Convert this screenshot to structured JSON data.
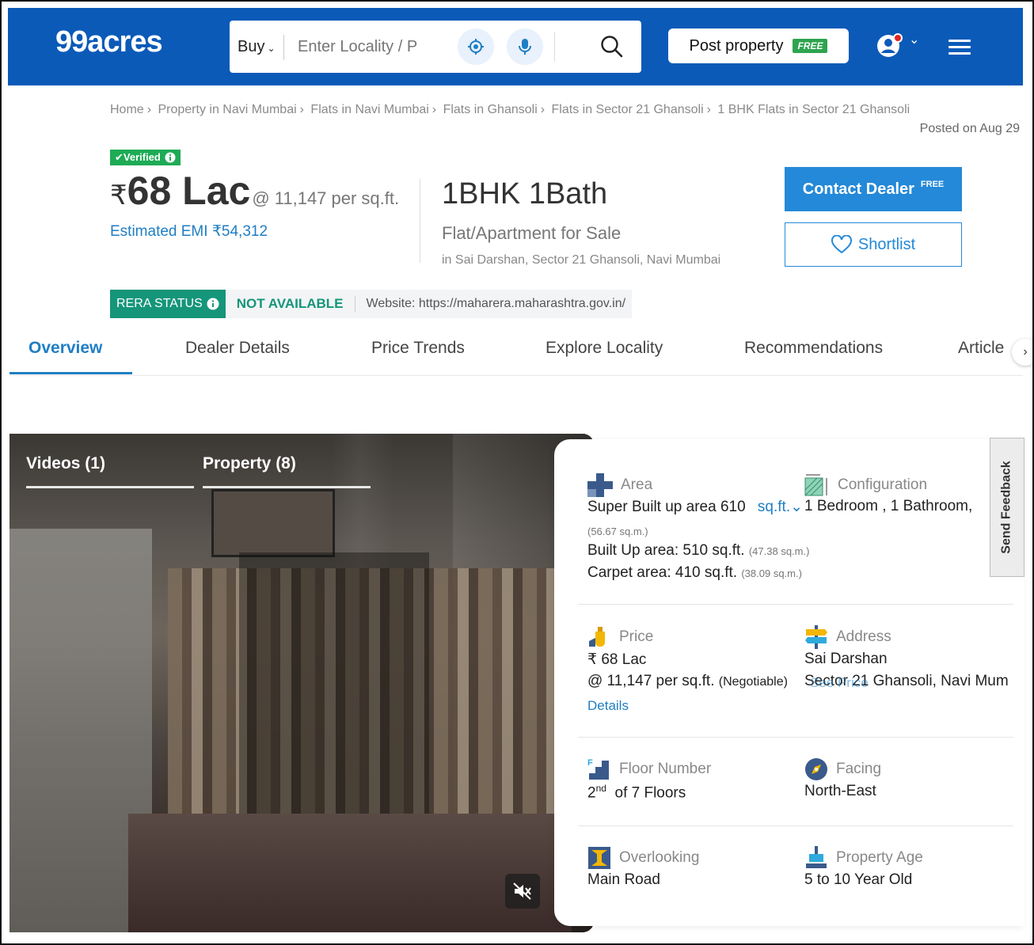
{
  "header": {
    "logo": "99acres",
    "search": {
      "mode": "Buy",
      "placeholder": "Enter Locality / P"
    },
    "post_property": {
      "label": "Post property",
      "badge": "FREE"
    }
  },
  "breadcrumb": {
    "items": [
      "Home",
      "Property in Navi Mumbai",
      "Flats in Navi Mumbai",
      "Flats in Ghansoli",
      "Flats in Sector 21 Ghansoli",
      "1 BHK Flats in Sector 21 Ghansoli"
    ],
    "separator": "›"
  },
  "posted_on": "Posted on Aug 29",
  "listing": {
    "verified": "Verified",
    "currency": "₹",
    "price": "68 Lac",
    "price_per_sqft": "@ 11,147 per sq.ft.",
    "emi": "Estimated EMI ₹54,312",
    "config": "1BHK 1Bath",
    "property_type": "Flat/Apartment for Sale",
    "location": "in Sai Darshan, Sector 21 Ghansoli, Navi Mumbai",
    "contact_label": "Contact Dealer",
    "contact_badge": "FREE",
    "shortlist_label": "Shortlist"
  },
  "rera": {
    "status_label": "RERA STATUS",
    "value": "NOT AVAILABLE",
    "website": "Website: https://maharera.maharashtra.gov.in/"
  },
  "tabs": [
    {
      "label": "Overview",
      "active": true
    },
    {
      "label": "Dealer Details"
    },
    {
      "label": "Price Trends"
    },
    {
      "label": "Explore Locality"
    },
    {
      "label": "Recommendations"
    },
    {
      "label": "Article"
    }
  ],
  "media": {
    "tabs": [
      "Videos (1)",
      "Property (8)"
    ]
  },
  "details": {
    "area": {
      "label": "Area",
      "super_built_up": "Super Built up area 610",
      "unit_link": "sq.ft.",
      "super_sqm": "(56.67 sq.m.)",
      "built_up": "Built Up area: 510 sq.ft.",
      "built_up_sqm": "(47.38 sq.m.)",
      "carpet": "Carpet area: 410 sq.ft.",
      "carpet_sqm": "(38.09 sq.m.)"
    },
    "configuration": {
      "label": "Configuration",
      "value": "1 Bedroom , 1 Bathroom,"
    },
    "price": {
      "label": "Price",
      "value": "₹ 68 Lac",
      "per_sqft": "@ 11,147 per sq.ft.",
      "negotiable": "(Negotiable)",
      "overlay_link": "See Price",
      "details_link": "Details"
    },
    "address": {
      "label": "Address",
      "line1": "Sai Darshan",
      "line2": "Sector 21 Ghansoli, Navi Mum"
    },
    "floor": {
      "label": "Floor Number",
      "floor_num": "2",
      "floor_sup": "nd",
      "floor_rest": "of 7 Floors"
    },
    "facing": {
      "label": "Facing",
      "value": "North-East"
    },
    "overlooking": {
      "label": "Overlooking",
      "value": "Main Road"
    },
    "age": {
      "label": "Property Age",
      "value": "5 to 10 Year Old"
    }
  },
  "feedback": "Send Feedback",
  "colors": {
    "brand_blue": "#0b5ab8",
    "link_blue": "#1f7ec4",
    "verified_green": "#1eab55",
    "rera_green": "#15957a"
  }
}
